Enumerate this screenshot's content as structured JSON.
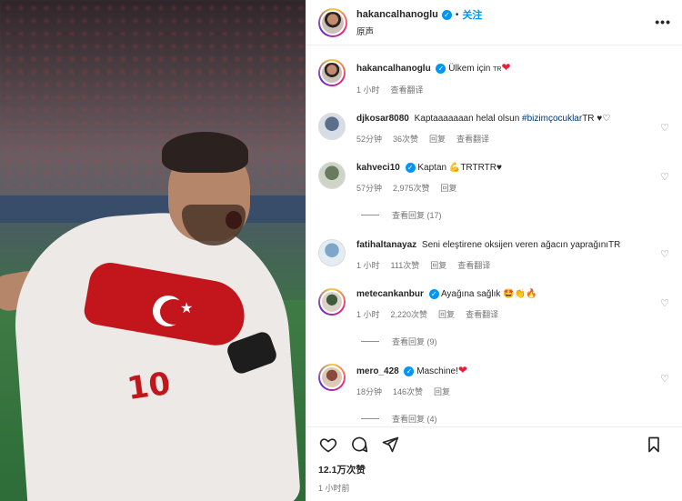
{
  "post": {
    "author": "hakancalhanoglu",
    "follow_label": "关注",
    "subtitle": "原声",
    "more_icon": "more-horizontal-icon"
  },
  "media": {
    "jersey_number": "10"
  },
  "caption": {
    "username": "hakancalhanoglu",
    "text": "Ülkem için",
    "flag_tag": "TR",
    "emoji": "❤",
    "time": "1 小时",
    "translate": "查看翻译"
  },
  "comments": [
    {
      "username": "djkosar8080",
      "text": "Kaptaaaaaaan helal olsun ",
      "hashtag": "#bizimçocuklar",
      "tail": "TR ♥♡",
      "time": "52分钟",
      "likes": "36次赞",
      "reply": "回复",
      "translate": "查看翻译",
      "verified": false
    },
    {
      "username": "kahveci10",
      "text": "Kaptan 💪TRTRTR♥",
      "time": "57分钟",
      "likes": "2,975次赞",
      "reply": "回复",
      "verified": true,
      "view_replies": "查看回复 (17)"
    },
    {
      "username": "fatihaltanayaz",
      "text": "Seni eleştirene oksijen veren ağacın yaprağınıTR",
      "time": "1 小时",
      "likes": "111次赞",
      "reply": "回复",
      "translate": "查看翻译",
      "verified": false
    },
    {
      "username": "metecankanbur",
      "text": "Ayağına sağlık 🤩👏🔥",
      "time": "1 小时",
      "likes": "2,220次赞",
      "reply": "回复",
      "translate": "查看翻译",
      "verified": true,
      "view_replies": "查看回复 (9)"
    },
    {
      "username": "mero_428",
      "text": "Maschine!",
      "emoji": "❤",
      "time": "18分钟",
      "likes": "146次赞",
      "reply": "回复",
      "verified": true,
      "view_replies": "查看回复 (4)"
    }
  ],
  "footer": {
    "likes": "12.1万次赞",
    "time": "1 小时前"
  },
  "colors": {
    "accent": "#0095f6",
    "heart": "#ed1c3c",
    "hashtag": "#00376b",
    "muted": "#737373"
  }
}
